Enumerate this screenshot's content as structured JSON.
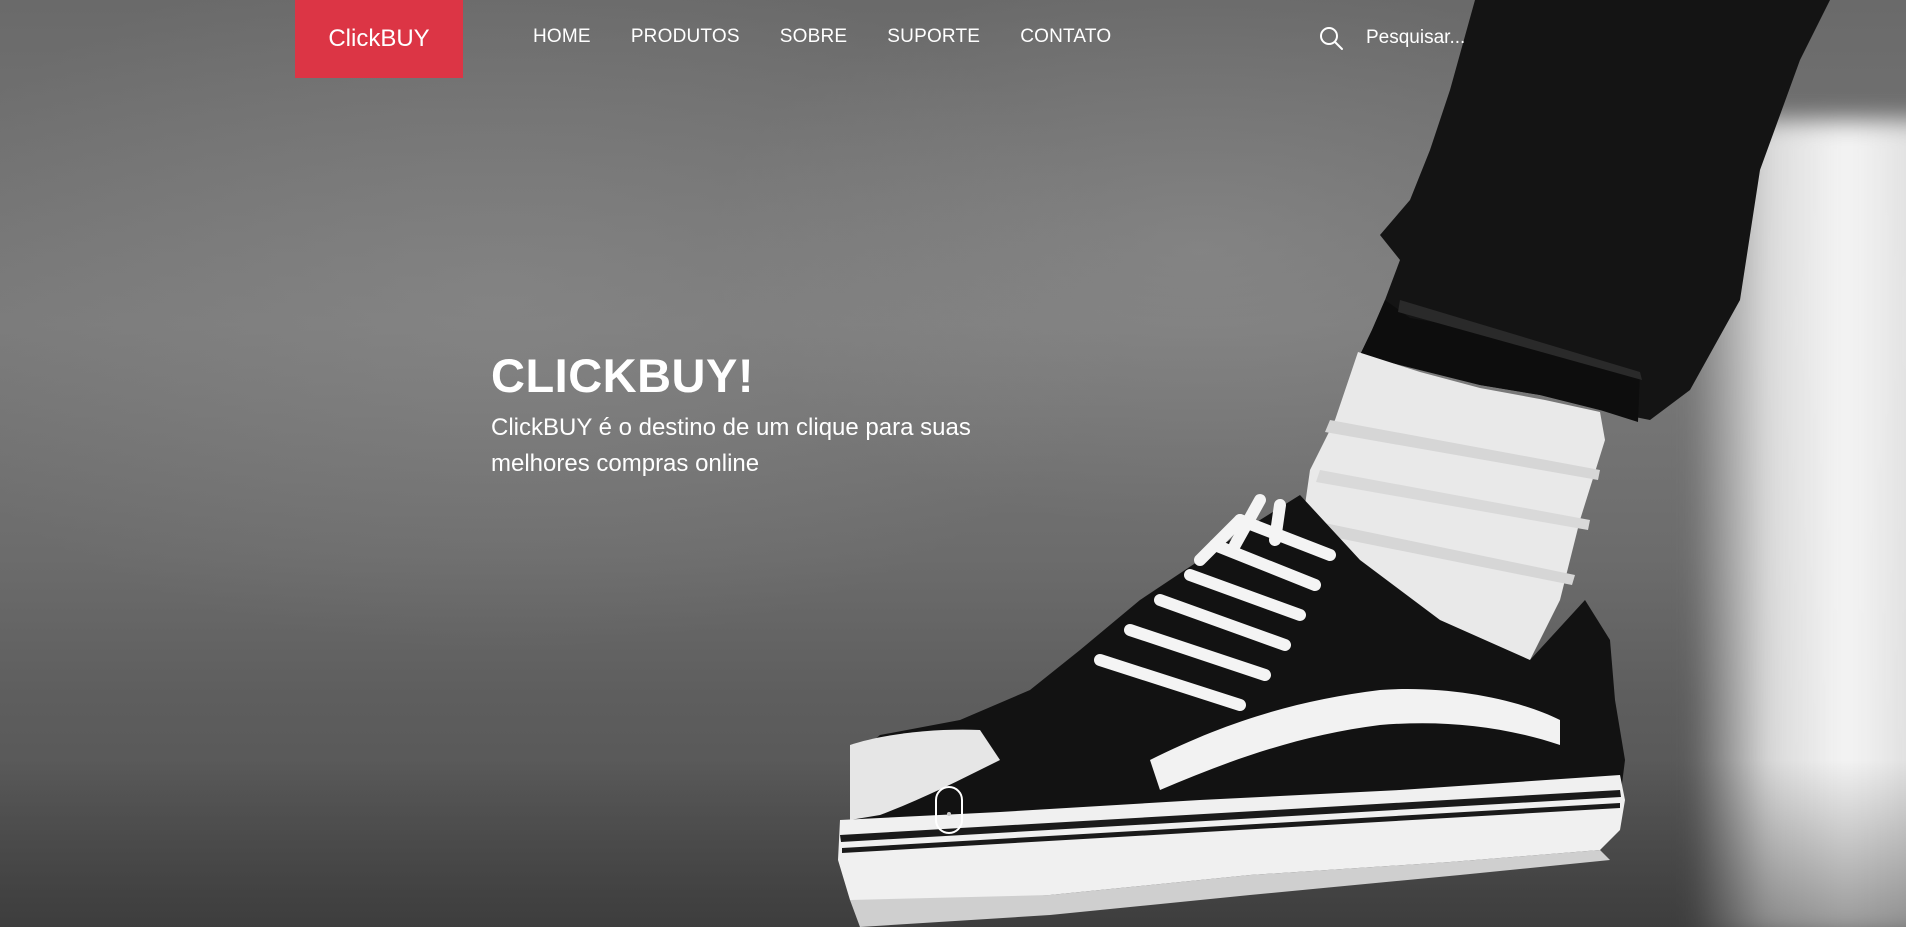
{
  "brand": {
    "label": "ClickBUY",
    "color": "#dc3545"
  },
  "nav": {
    "items": [
      {
        "label": "HOME"
      },
      {
        "label": "PRODUTOS"
      },
      {
        "label": "SOBRE"
      },
      {
        "label": "SUPORTE"
      },
      {
        "label": "CONTATO"
      }
    ]
  },
  "search": {
    "placeholder": "Pesquisar...",
    "icon": "search-icon"
  },
  "hero": {
    "title": "CLICKBUY!",
    "subtitle": "ClickBUY é o destino de um clique para suas melhores compras online"
  },
  "scroll_indicator": {
    "icon": "mouse-scroll-icon"
  }
}
